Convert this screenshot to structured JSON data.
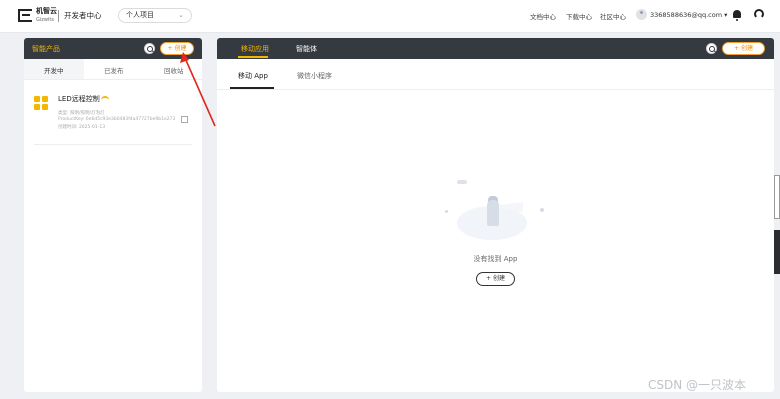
{
  "topbar": {
    "brand_cn": "机智云",
    "brand_en": "Gizwits",
    "dev_center": "开发者中心",
    "project_select": "个人项目",
    "nav": [
      "文档中心",
      "下载中心",
      "社区中心"
    ],
    "email": "3368588636@qq.com ▾"
  },
  "left_panel": {
    "title": "智能产品",
    "create_label": "+ 创建",
    "tabs": [
      "开发中",
      "已发布",
      "回收站"
    ],
    "device": {
      "name": "LED远程控制",
      "category": "类型: 照明/照明/灯泡灯",
      "product_key": "ProductKey: 6e6d5c93e3b0483f4a47727be9b1e273",
      "created": "创建时间: 2025-01-13"
    }
  },
  "right_panel": {
    "tabs": [
      "移动应用",
      "智能体"
    ],
    "create_label": "+ 创建",
    "subtabs": [
      "移动 App",
      "微信小程序"
    ],
    "empty_text": "没有找到 App",
    "empty_create": "+ 创建"
  },
  "watermark": "CSDN @一只波本"
}
